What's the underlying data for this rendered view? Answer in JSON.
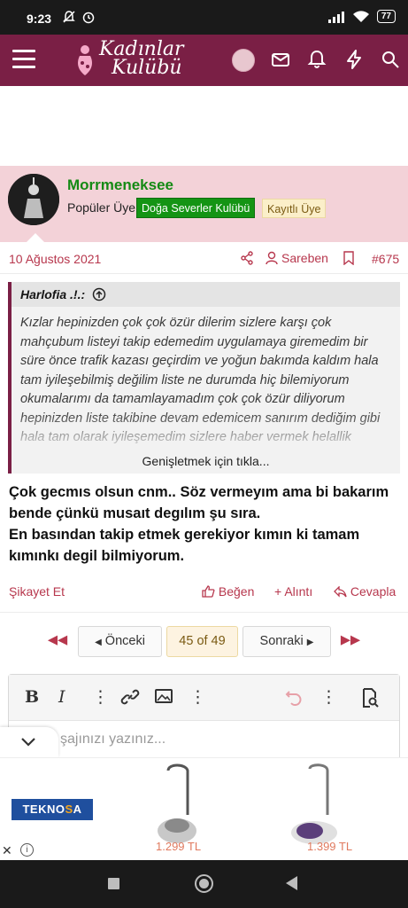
{
  "status_bar": {
    "time": "9:23",
    "battery": "77"
  },
  "header": {
    "logo_line1": "Kadınlar",
    "logo_line2": "Kulübü",
    "icons": [
      "menu-icon",
      "avatar",
      "mail-icon",
      "bell-icon",
      "lightning-icon",
      "search-icon"
    ]
  },
  "post": {
    "username": "Morrmeneksee",
    "user_title": "Popüler Üye",
    "badge_group": "Doğa Severler Kulübü",
    "badge_registered": "Kayıtlı Üye",
    "date": "10 Ağustos 2021",
    "author_label": "Sareben",
    "post_number": "#675",
    "quote": {
      "author": "Harlofia .!.:",
      "text": "Kızlar hepinizden çok çok özür dilerim sizlere karşı çok mahçubum listeyi takip edemedim uygulamaya giremedim bir süre önce trafik kazası geçirdim ve yoğun bakımda kaldım hala tam iyileşebilmiş değilim liste ne durumda hiç bilemiyorum okumalarımı da tamamlayamadım çok çok özür diliyorum hepinizden liste takibine devam edemicem sanırım dediğim gibi hala tam olarak iyileşemedim sizlere haber vermek helallik",
      "expand_label": "Genişletmek için tıkla..."
    },
    "reply_line1": "Çok gecmıs olsun cnm.. Söz vermeyım ama bi bakarım bende çünkü musaıt degılım şu sıra.",
    "reply_line2": "En basından takip etmek gerekiyor kımın ki tamam kımınkı degil bilmiyorum.",
    "actions": {
      "report": "Şikayet Et",
      "like": "Beğen",
      "quote": "Alıntı",
      "reply": "Cevapla"
    }
  },
  "pagination": {
    "prev": "Önceki",
    "current": "45 of 49",
    "next": "Sonraki"
  },
  "editor": {
    "placeholder": "şajınızı yazınız..."
  },
  "ad": {
    "brand": "TEKNOSA",
    "price1": "1.299 TL",
    "price2": "1.399 TL"
  },
  "colors": {
    "brand": "#7a1f45",
    "user_bar": "#f3d2d8",
    "accent": "#b7374d",
    "username": "#148a14"
  }
}
